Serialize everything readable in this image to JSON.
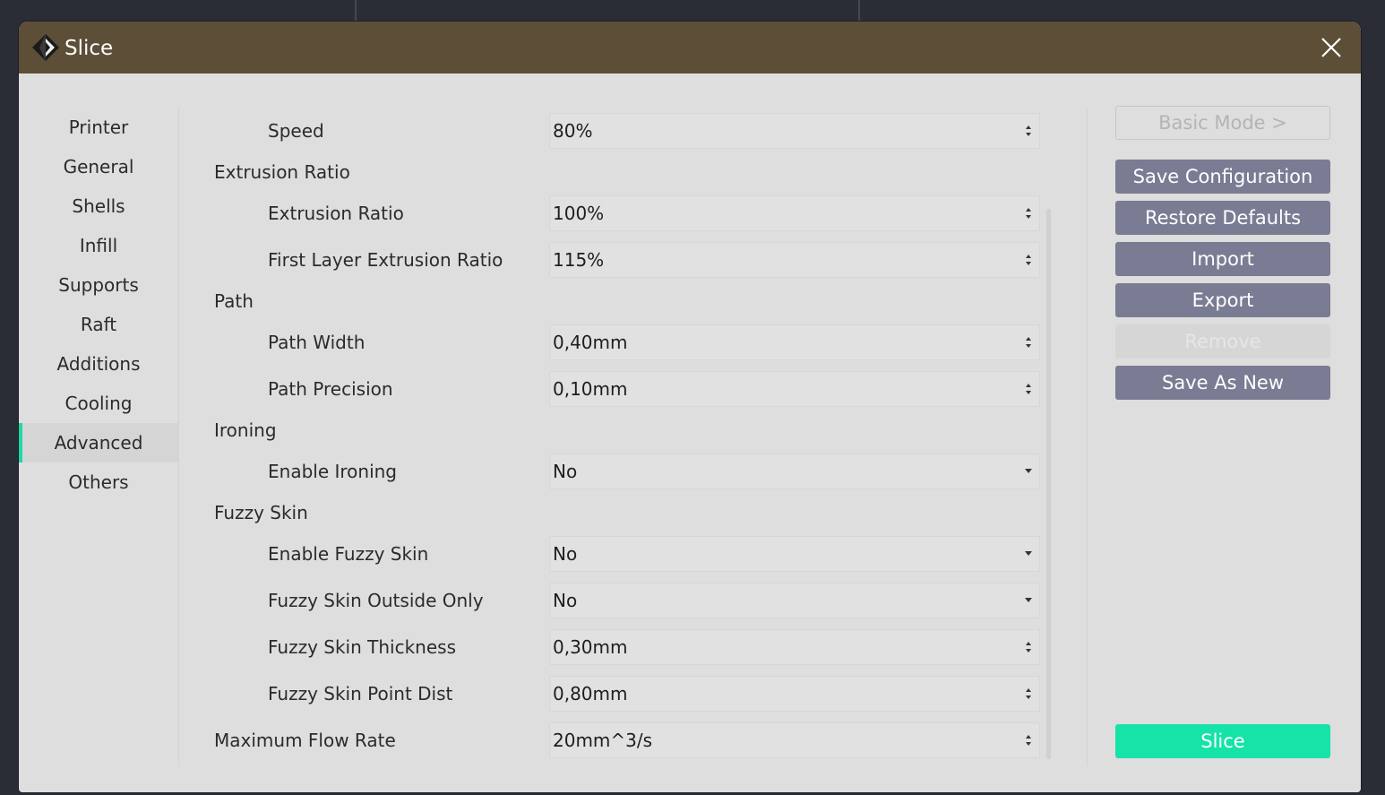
{
  "dialog": {
    "title": "Slice"
  },
  "sidebar": {
    "items": [
      {
        "label": "Printer"
      },
      {
        "label": "General"
      },
      {
        "label": "Shells"
      },
      {
        "label": "Infill"
      },
      {
        "label": "Supports"
      },
      {
        "label": "Raft"
      },
      {
        "label": "Additions"
      },
      {
        "label": "Cooling"
      },
      {
        "label": "Advanced",
        "active": true
      },
      {
        "label": "Others"
      }
    ]
  },
  "settings": {
    "speed": {
      "label": "Speed",
      "value": "80%"
    },
    "extrusion_group": {
      "label": "Extrusion Ratio"
    },
    "extrusion_ratio": {
      "label": "Extrusion Ratio",
      "value": "100%"
    },
    "first_layer_extrusion_ratio": {
      "label": "First Layer Extrusion Ratio",
      "value": "115%"
    },
    "path_group": {
      "label": "Path"
    },
    "path_width": {
      "label": "Path Width",
      "value": "0,40mm"
    },
    "path_precision": {
      "label": "Path Precision",
      "value": "0,10mm"
    },
    "ironing_group": {
      "label": "Ironing"
    },
    "enable_ironing": {
      "label": "Enable Ironing",
      "value": "No"
    },
    "fuzzy_group": {
      "label": "Fuzzy Skin"
    },
    "enable_fuzzy_skin": {
      "label": "Enable Fuzzy Skin",
      "value": "No"
    },
    "fuzzy_skin_outside_only": {
      "label": "Fuzzy Skin Outside Only",
      "value": "No"
    },
    "fuzzy_skin_thickness": {
      "label": "Fuzzy Skin Thickness",
      "value": "0,30mm"
    },
    "fuzzy_skin_point_dist": {
      "label": "Fuzzy Skin Point Dist",
      "value": "0,80mm"
    },
    "maximum_flow_rate": {
      "label": "Maximum Flow Rate",
      "value": "20mm^3/s"
    }
  },
  "actions": {
    "basic_mode": "Basic Mode >",
    "save_configuration": "Save Configuration",
    "restore_defaults": "Restore Defaults",
    "import": "Import",
    "export": "Export",
    "remove": "Remove",
    "save_as_new": "Save As New",
    "slice": "Slice"
  },
  "colors": {
    "titlebar": "#5c4e37",
    "accent": "#1ed9a5",
    "button": "#7a7c93",
    "slice_button": "#15e3a8"
  }
}
